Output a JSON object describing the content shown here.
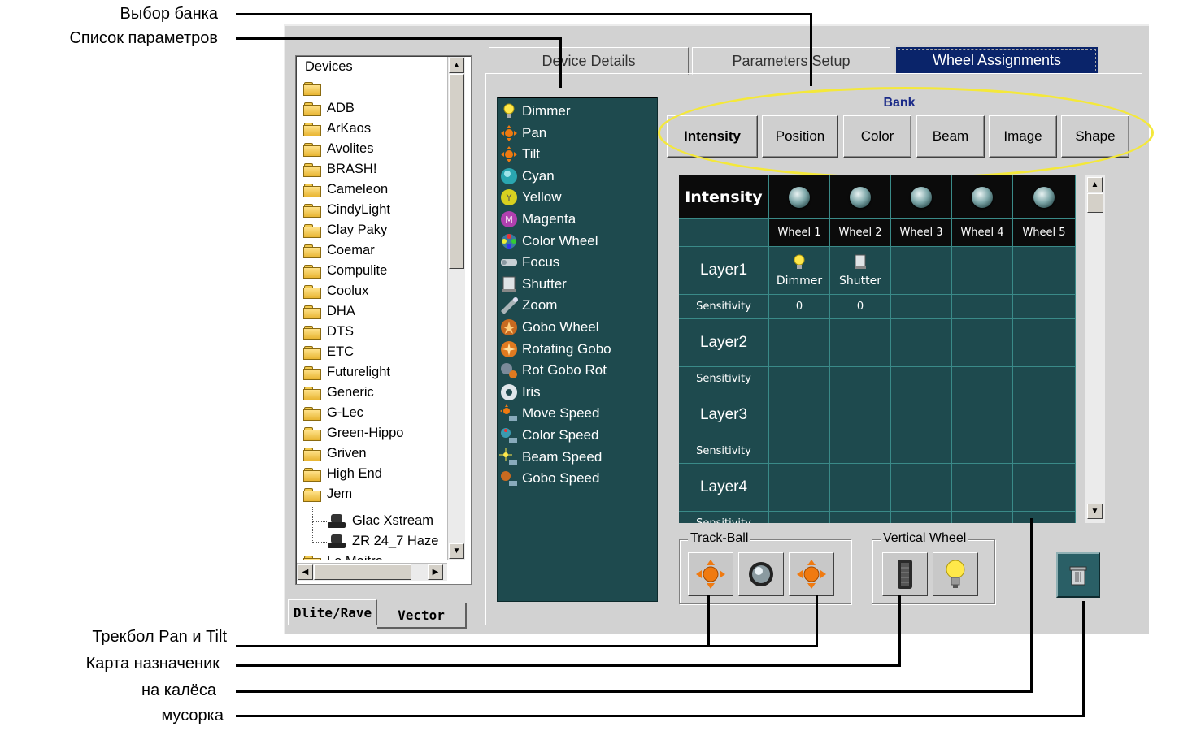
{
  "annotations": {
    "bank_select": "Выбор банка",
    "param_list": "Список параметров",
    "trackball": "Трекбол Pan и Tilt",
    "wheel_map_1": "Карта назначеник",
    "wheel_map_2": "на калёса",
    "trash": "мусорка"
  },
  "devices": {
    "root": "Devices",
    "folders": [
      "",
      "ADB",
      "ArKaos",
      "Avolites",
      "BRASH!",
      "Cameleon",
      "CindyLight",
      "Clay Paky",
      "Coemar",
      "Compulite",
      "Coolux",
      "DHA",
      "DTS",
      "ETC",
      "Futurelight",
      "Generic",
      "G-Lec",
      "Green-Hippo",
      "Griven",
      "High End",
      "Jem"
    ],
    "jem_children": [
      "Glac Xstream",
      "ZR 24_7 Haze"
    ],
    "last_folder": "Le Maitre"
  },
  "bottom_tabs": [
    "Dlite/Rave",
    "Vector"
  ],
  "main_tabs": [
    "Device Details",
    "Parameters Setup",
    "Wheel Assignments"
  ],
  "active_tab": "Wheel Assignments",
  "params": [
    "Dimmer",
    "Pan",
    "Tilt",
    "Cyan",
    "Yellow",
    "Magenta",
    "Color Wheel",
    "Focus",
    "Shutter",
    "Zoom",
    "Gobo Wheel",
    "Rotating Gobo",
    "Rot Gobo Rot",
    "Iris",
    "Move Speed",
    "Color Speed",
    "Beam Speed",
    "Gobo Speed"
  ],
  "bank": {
    "title": "Bank",
    "buttons": [
      "Intensity",
      "Position",
      "Color",
      "Beam",
      "Image",
      "Shape"
    ],
    "active": "Intensity"
  },
  "grid": {
    "bank_label": "Intensity",
    "wheels": [
      "Wheel 1",
      "Wheel 2",
      "Wheel 3",
      "Wheel 4",
      "Wheel 5"
    ],
    "layers": [
      "Layer1",
      "Layer2",
      "Layer3",
      "Layer4"
    ],
    "sensitivity_label": "Sensitivity",
    "layer1_assign": [
      "Dimmer",
      "Shutter"
    ],
    "layer1_sens": [
      "0",
      "0"
    ],
    "partial_label": "Sensitivity"
  },
  "trackball": {
    "label": "Track-Ball"
  },
  "vertical_wheel": {
    "label": "Vertical Wheel"
  },
  "colors": {
    "panel": "#1e4a4e",
    "grid_line": "#3a8a88",
    "active_tab": "#0a246a",
    "bank_title": "#1a2a88",
    "highlight": "#f4e83a"
  }
}
